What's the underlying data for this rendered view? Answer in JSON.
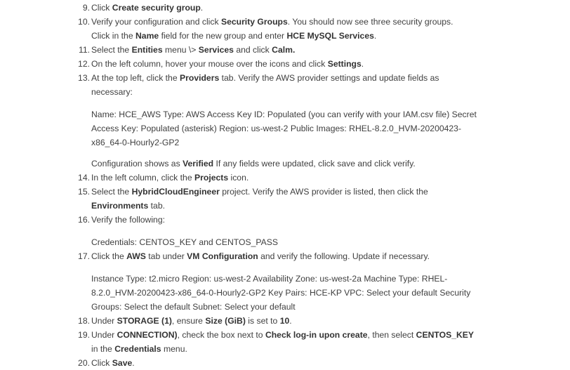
{
  "steps": [
    {
      "number": "9.",
      "lines": [
        [
          "Click ",
          "**Create security group**",
          "."
        ]
      ]
    },
    {
      "number": "10.",
      "lines": [
        [
          "Verify your configuration and click ",
          "**Security Groups**",
          ". You should now see three security groups."
        ],
        [
          "Click in the ",
          "**Name**",
          " field for the new group and enter ",
          "**HCE MySQL Services**",
          "."
        ]
      ]
    },
    {
      "number": "11.",
      "lines": [
        [
          "Select the ",
          "**Entities**",
          " menu \\> ",
          "**Services**",
          " and click ",
          "**Calm.**"
        ]
      ]
    },
    {
      "number": "12.",
      "lines": [
        [
          "On the left column, hover your mouse over the icons and click ",
          "**Settings**",
          "."
        ]
      ]
    },
    {
      "number": "13.",
      "lines": [
        [
          "At the top left, click the ",
          "**Providers**",
          " tab. Verify the AWS provider settings and update fields as"
        ],
        [
          "necessary:"
        ]
      ]
    },
    {
      "number": "",
      "lines": [
        [
          "Name: HCE_AWS Type: AWS Access Key ID: Populated (you can verify with your IAM.csv file) Secret"
        ],
        [
          "Access Key: Populated (asterisk) Region: us-west-2 Public Images: RHEL-8.2.0_HVM-20200423-"
        ],
        [
          "x86_64-0-Hourly2-GP2"
        ]
      ]
    },
    {
      "number": "",
      "lines": [
        [
          "Configuration shows as ",
          "**Verified**",
          " If any fields were updated, click save and click verify."
        ]
      ]
    },
    {
      "number": "14.",
      "lines": [
        [
          "In the left column, click the ",
          "**Projects**",
          " icon."
        ]
      ]
    },
    {
      "number": "15.",
      "lines": [
        [
          "Select the ",
          "**HybridCloudEngineer**",
          " project. Verify the AWS provider is listed, then click the"
        ],
        [
          "**Environments**",
          " tab."
        ]
      ]
    },
    {
      "number": "16.",
      "lines": [
        [
          "Verify the following:"
        ]
      ]
    },
    {
      "number": "",
      "lines": [
        [
          "Credentials: CENTOS_KEY and CENTOS_PASS"
        ]
      ]
    },
    {
      "number": "17.",
      "lines": [
        [
          "Click the ",
          "**AWS**",
          " tab under ",
          "**VM Configuration**",
          " and verify the following. Update if necessary."
        ]
      ]
    },
    {
      "number": "",
      "lines": [
        [
          "Instance Type: t2.micro Region: us-west-2 Availability Zone: us-west-2a Machine Type: RHEL-"
        ],
        [
          "8.2.0_HVM-20200423-x86_64-0-Hourly2-GP2 Key Pairs: HCE-KP VPC: Select your default Security"
        ],
        [
          "Groups: Select the default Subnet: Select your default"
        ]
      ]
    },
    {
      "number": "18.",
      "lines": [
        [
          "Under ",
          "**STORAGE (1)**",
          ", ensure ",
          "**Size (GiB)**",
          " is set to ",
          "**10**",
          "."
        ]
      ]
    },
    {
      "number": "19.",
      "lines": [
        [
          "Under ",
          "**CONNECTION)**",
          ", check the box next to ",
          "**Check log-in upon create**",
          ", then select ",
          "**CENTOS_KEY**"
        ],
        [
          "in the ",
          "**Credentials**",
          " menu."
        ]
      ]
    },
    {
      "number": "20.",
      "lines": [
        [
          "Click ",
          "**Save**",
          "."
        ]
      ]
    }
  ]
}
